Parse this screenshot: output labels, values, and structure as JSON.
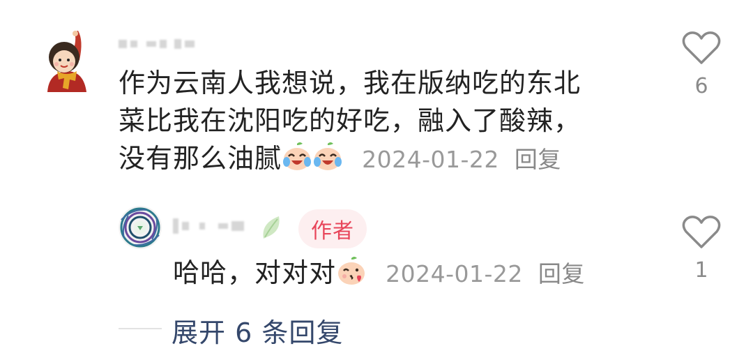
{
  "comment": {
    "text_line1": "作为云南人我想说，我在版纳吃的东北",
    "text_line2": "菜比我在沈阳吃的好吃，融入了酸辣，",
    "text_line3": "没有那么油腻",
    "emojis": [
      "crying-laughing-peach-emoji",
      "crying-laughing-peach-emoji"
    ],
    "date": "2024-01-22",
    "reply_label": "回复",
    "like_count": "6"
  },
  "reply": {
    "badge": "作者",
    "text": "哈哈，对对对",
    "emoji": "kissing-peach-emoji",
    "date": "2024-01-22",
    "reply_label": "回复",
    "like_count": "1"
  },
  "expand": {
    "label": "展开 6 条回复"
  },
  "icons": {
    "like": "heart-outline-icon",
    "leaf": "leaf-icon"
  },
  "colors": {
    "text": "#222222",
    "meta": "#999999",
    "author_badge_bg": "#fdeff0",
    "author_badge_text": "#e8455a",
    "expand_link": "#34476b"
  }
}
